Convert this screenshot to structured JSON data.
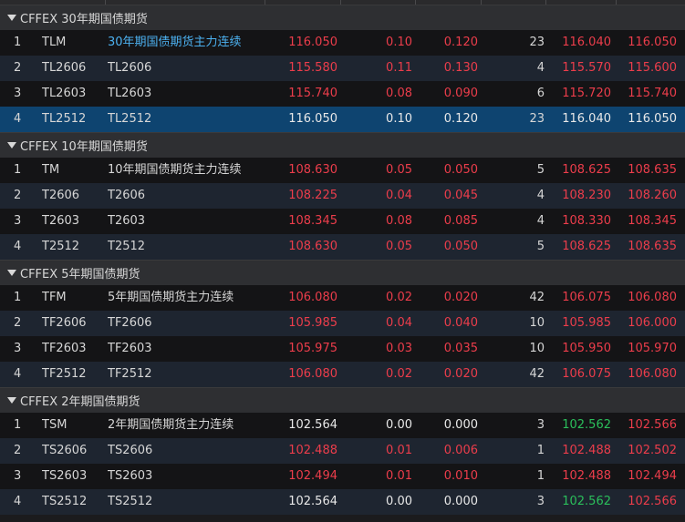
{
  "colors": {
    "up": "#ec3d4b",
    "down": "#2bbf5b",
    "flat": "#e8e8e8",
    "highlight": "#4cb1f0",
    "selected_row": "#0e4470"
  },
  "groups": [
    {
      "title": "CFFEX 30年期国债期货",
      "rows": [
        {
          "idx": "1",
          "code": "TLM",
          "name": "30年期国债期货主力连续",
          "last": "116.050",
          "chg": "0.10",
          "pct": "0.120",
          "vol": "23",
          "bid": "116.040",
          "ask": "116.050",
          "last_color": "up",
          "chg_color": "up",
          "pct_color": "up",
          "bid_color": "up",
          "ask_color": "up",
          "state": "highlight"
        },
        {
          "idx": "2",
          "code": "TL2606",
          "name": "TL2606",
          "last": "115.580",
          "chg": "0.11",
          "pct": "0.130",
          "vol": "4",
          "bid": "115.570",
          "ask": "115.600",
          "last_color": "up",
          "chg_color": "up",
          "pct_color": "up",
          "bid_color": "up",
          "ask_color": "up",
          "state": ""
        },
        {
          "idx": "3",
          "code": "TL2603",
          "name": "TL2603",
          "last": "115.740",
          "chg": "0.08",
          "pct": "0.090",
          "vol": "6",
          "bid": "115.720",
          "ask": "115.740",
          "last_color": "up",
          "chg_color": "up",
          "pct_color": "up",
          "bid_color": "up",
          "ask_color": "up",
          "state": ""
        },
        {
          "idx": "4",
          "code": "TL2512",
          "name": "TL2512",
          "last": "116.050",
          "chg": "0.10",
          "pct": "0.120",
          "vol": "23",
          "bid": "116.040",
          "ask": "116.050",
          "last_color": "flat",
          "chg_color": "flat",
          "pct_color": "flat",
          "bid_color": "flat",
          "ask_color": "flat",
          "state": "selected"
        }
      ]
    },
    {
      "title": "CFFEX 10年期国债期货",
      "rows": [
        {
          "idx": "1",
          "code": "TM",
          "name": "10年期国债期货主力连续",
          "last": "108.630",
          "chg": "0.05",
          "pct": "0.050",
          "vol": "5",
          "bid": "108.625",
          "ask": "108.635",
          "last_color": "up",
          "chg_color": "up",
          "pct_color": "up",
          "bid_color": "up",
          "ask_color": "up",
          "state": ""
        },
        {
          "idx": "2",
          "code": "T2606",
          "name": "T2606",
          "last": "108.225",
          "chg": "0.04",
          "pct": "0.045",
          "vol": "4",
          "bid": "108.230",
          "ask": "108.260",
          "last_color": "up",
          "chg_color": "up",
          "pct_color": "up",
          "bid_color": "up",
          "ask_color": "up",
          "state": ""
        },
        {
          "idx": "3",
          "code": "T2603",
          "name": "T2603",
          "last": "108.345",
          "chg": "0.08",
          "pct": "0.085",
          "vol": "4",
          "bid": "108.330",
          "ask": "108.345",
          "last_color": "up",
          "chg_color": "up",
          "pct_color": "up",
          "bid_color": "up",
          "ask_color": "up",
          "state": ""
        },
        {
          "idx": "4",
          "code": "T2512",
          "name": "T2512",
          "last": "108.630",
          "chg": "0.05",
          "pct": "0.050",
          "vol": "5",
          "bid": "108.625",
          "ask": "108.635",
          "last_color": "up",
          "chg_color": "up",
          "pct_color": "up",
          "bid_color": "up",
          "ask_color": "up",
          "state": ""
        }
      ]
    },
    {
      "title": "CFFEX 5年期国债期货",
      "rows": [
        {
          "idx": "1",
          "code": "TFM",
          "name": "5年期国债期货主力连续",
          "last": "106.080",
          "chg": "0.02",
          "pct": "0.020",
          "vol": "42",
          "bid": "106.075",
          "ask": "106.080",
          "last_color": "up",
          "chg_color": "up",
          "pct_color": "up",
          "bid_color": "up",
          "ask_color": "up",
          "state": ""
        },
        {
          "idx": "2",
          "code": "TF2606",
          "name": "TF2606",
          "last": "105.985",
          "chg": "0.04",
          "pct": "0.040",
          "vol": "10",
          "bid": "105.985",
          "ask": "106.000",
          "last_color": "up",
          "chg_color": "up",
          "pct_color": "up",
          "bid_color": "up",
          "ask_color": "up",
          "state": ""
        },
        {
          "idx": "3",
          "code": "TF2603",
          "name": "TF2603",
          "last": "105.975",
          "chg": "0.03",
          "pct": "0.035",
          "vol": "10",
          "bid": "105.950",
          "ask": "105.970",
          "last_color": "up",
          "chg_color": "up",
          "pct_color": "up",
          "bid_color": "up",
          "ask_color": "up",
          "state": ""
        },
        {
          "idx": "4",
          "code": "TF2512",
          "name": "TF2512",
          "last": "106.080",
          "chg": "0.02",
          "pct": "0.020",
          "vol": "42",
          "bid": "106.075",
          "ask": "106.080",
          "last_color": "up",
          "chg_color": "up",
          "pct_color": "up",
          "bid_color": "up",
          "ask_color": "up",
          "state": ""
        }
      ]
    },
    {
      "title": "CFFEX 2年期国债期货",
      "rows": [
        {
          "idx": "1",
          "code": "TSM",
          "name": "2年期国债期货主力连续",
          "last": "102.564",
          "chg": "0.00",
          "pct": "0.000",
          "vol": "3",
          "bid": "102.562",
          "ask": "102.566",
          "last_color": "flat",
          "chg_color": "flat",
          "pct_color": "flat",
          "bid_color": "down",
          "ask_color": "up",
          "state": ""
        },
        {
          "idx": "2",
          "code": "TS2606",
          "name": "TS2606",
          "last": "102.488",
          "chg": "0.01",
          "pct": "0.006",
          "vol": "1",
          "bid": "102.488",
          "ask": "102.502",
          "last_color": "up",
          "chg_color": "up",
          "pct_color": "up",
          "bid_color": "up",
          "ask_color": "up",
          "state": ""
        },
        {
          "idx": "3",
          "code": "TS2603",
          "name": "TS2603",
          "last": "102.494",
          "chg": "0.01",
          "pct": "0.010",
          "vol": "1",
          "bid": "102.488",
          "ask": "102.494",
          "last_color": "up",
          "chg_color": "up",
          "pct_color": "up",
          "bid_color": "up",
          "ask_color": "up",
          "state": ""
        },
        {
          "idx": "4",
          "code": "TS2512",
          "name": "TS2512",
          "last": "102.564",
          "chg": "0.00",
          "pct": "0.000",
          "vol": "3",
          "bid": "102.562",
          "ask": "102.566",
          "last_color": "flat",
          "chg_color": "flat",
          "pct_color": "flat",
          "bid_color": "down",
          "ask_color": "up",
          "state": ""
        }
      ]
    }
  ]
}
